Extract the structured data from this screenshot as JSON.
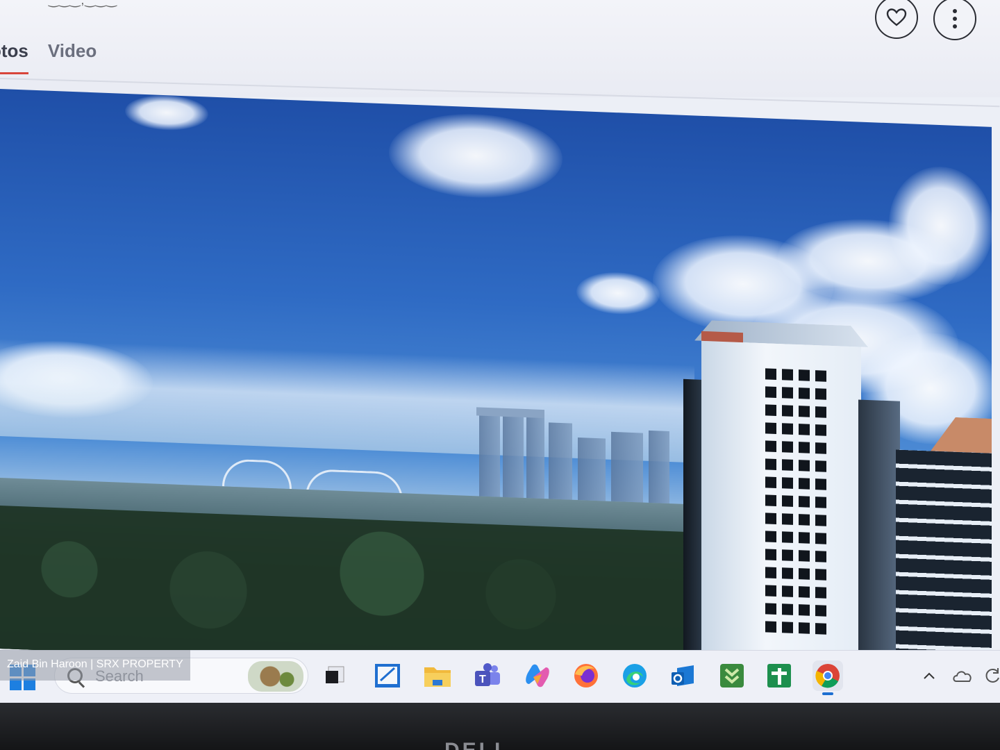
{
  "header": {
    "subtext": "‿‿‿,‿‿‿",
    "tabs": [
      {
        "label": "otos",
        "active": true
      },
      {
        "label": "Video",
        "active": false
      }
    ],
    "actions": {
      "favorite_icon": "heart-icon",
      "more_icon": "more-vertical-icon"
    }
  },
  "taskbar": {
    "search_placeholder": "Search",
    "apps": [
      "task-view-icon",
      "snipping-tool-icon",
      "file-explorer-icon",
      "teams-icon",
      "copilot-icon",
      "firefox-icon",
      "edge-icon",
      "outlook-icon",
      "download-app-icon",
      "add-app-icon",
      "chrome-icon"
    ],
    "active_app": "chrome-icon",
    "tray": [
      "chevron-up-icon",
      "onedrive-icon",
      "sync-icon"
    ]
  },
  "watermark": "Zaid Bin Haroon | SRX PROPERTY",
  "bezel_logo": "DELL",
  "colors": {
    "accent": "#d8453a",
    "taskbar_bg": "#eef0f7",
    "sky": "#2f6bc4"
  }
}
